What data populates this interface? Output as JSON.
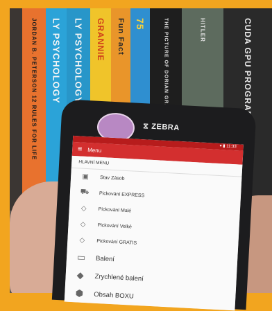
{
  "photo": {
    "book_spines": [
      {
        "text": "JORDAN B. PETERSON   12 RULES FOR LIFE",
        "color": "#e8722e",
        "text_color": "#1d1d1d"
      },
      {
        "text": "LY PSYCHOLOGY",
        "color": "#2ba3d8",
        "text_color": "#f5f5f5"
      },
      {
        "text": "LY PSYCHOLOGY",
        "color": "#2896c9",
        "text_color": "#f5f5f5"
      },
      {
        "text": "GRANNIE",
        "color": "#f0c42a",
        "text_color": "#d0401a"
      },
      {
        "text": "Fun Fact",
        "color": "#e9952a",
        "text_color": "#2a2a2a"
      },
      {
        "text": "75",
        "color": "#2f8fd0",
        "text_color": "#f8d23a"
      },
      {
        "text": "THE PICTURE OF DORIAN GRAY",
        "color": "#1e1e1e",
        "text_color": "#e0e0e0"
      },
      {
        "text": "HITLER",
        "color": "#5d6b5e",
        "text_color": "#e0e0e0"
      },
      {
        "text": "CUDA GPU PROGRAMMING",
        "color": "#2a2a2a",
        "text_color": "#ececec"
      }
    ]
  },
  "phone": {
    "brand": "ZEBRA",
    "status_time": "11:33"
  },
  "app": {
    "title": "Menu",
    "section": "HLAVNÍ MENU",
    "items": [
      {
        "label": "Stav Zásob",
        "icon": "box-outline-icon"
      },
      {
        "label": "Pickování EXPRESS",
        "icon": "truck-icon"
      },
      {
        "label": "Pickování Malé",
        "icon": "diamond-icon"
      },
      {
        "label": "Pickování Velké",
        "icon": "diamond-icon"
      },
      {
        "label": "Pickování GRATIS",
        "icon": "diamond-icon"
      },
      {
        "label": "Balení",
        "icon": "package-outline-icon"
      },
      {
        "label": "Zrychlené balení",
        "icon": "bag-icon"
      },
      {
        "label": "Obsah BOXU",
        "icon": "cube-icon"
      }
    ]
  }
}
